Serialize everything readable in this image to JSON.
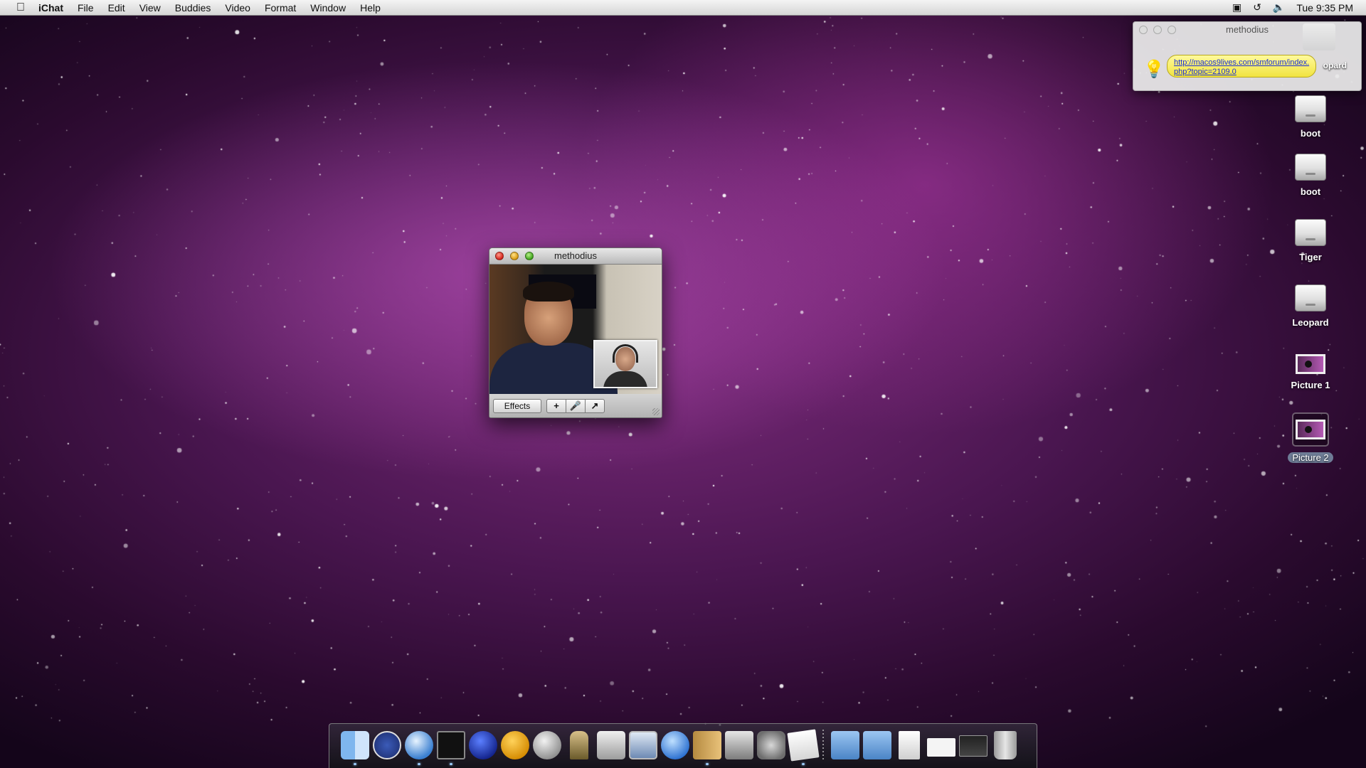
{
  "menubar": {
    "apple_icon": "apple-icon",
    "app_name": "iChat",
    "menus": [
      "File",
      "Edit",
      "View",
      "Buddies",
      "Video",
      "Format",
      "Window",
      "Help"
    ],
    "status_icons": [
      "input-menu-icon",
      "time-machine-icon",
      "volume-icon"
    ],
    "clock": "Tue 9:35 PM"
  },
  "chat_window": {
    "title": "methodius",
    "effects_label": "Effects",
    "add_label": "+",
    "mute_icon": "microphone-icon",
    "fullscreen_icon": "fullscreen-icon"
  },
  "notification": {
    "title": "methodius",
    "link": "http://macos9lives.com/smforum/index.php?topic=2109.0",
    "behind_label": "opard",
    "icon": "lightbulb-icon"
  },
  "desktop_icons": [
    {
      "label": "boot",
      "type": "drive"
    },
    {
      "label": "boot",
      "type": "drive"
    },
    {
      "label": "Tiger",
      "type": "drive"
    },
    {
      "label": "Leopard",
      "type": "drive"
    },
    {
      "label": "Picture 1",
      "type": "picture"
    },
    {
      "label": "Picture 2",
      "type": "picture",
      "selected": true
    }
  ],
  "dock": {
    "items": [
      "finder-icon",
      "app-store-icon",
      "network-globe-icon",
      "terminal-icon",
      "blue-balloon-icon",
      "orange-balloon-icon",
      "gray-balloon-icon",
      "utility-app-icon",
      "disk-utility-icon",
      "ichat-screen-icon",
      "facetime-camera-icon",
      "address-book-icon",
      "dashboard-icon",
      "system-preferences-icon",
      "textedit-icon",
      "applications-folder-icon",
      "utilities-folder-icon",
      "documents-stack-icon",
      "blank-document-icon",
      "window-stack-icon",
      "trash-icon"
    ]
  },
  "colors": {
    "desktop_purple": "#7a2a7a",
    "link_blue": "#1a2fd6",
    "bubble_yellow": "#f1e340"
  }
}
